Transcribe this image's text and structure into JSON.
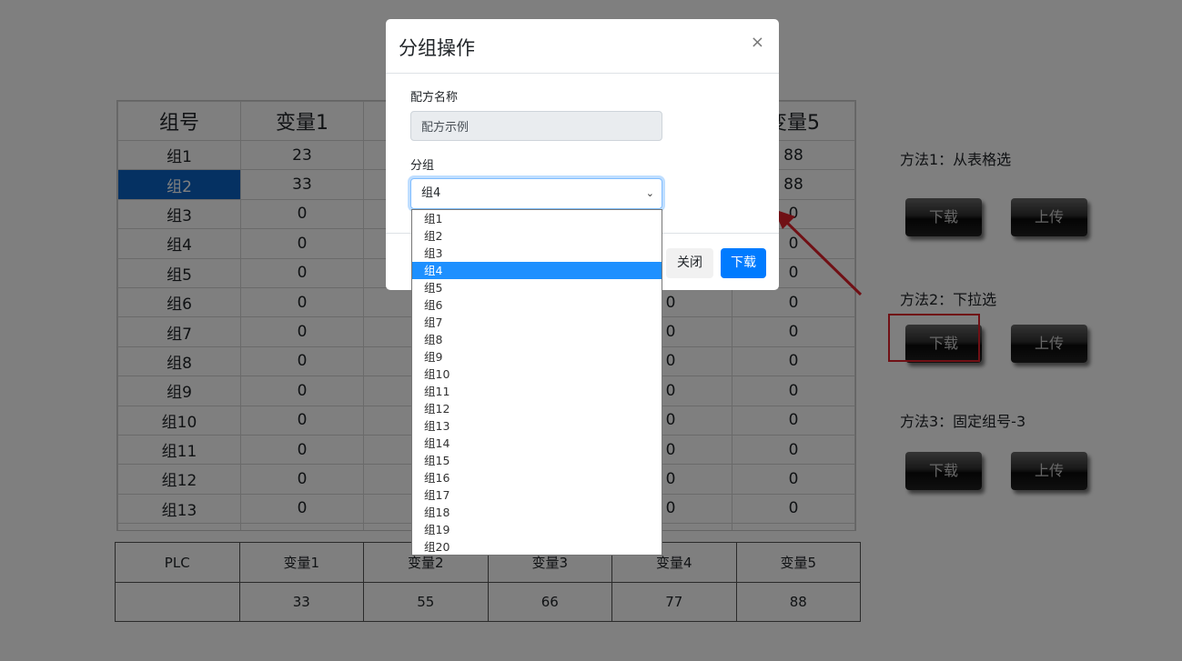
{
  "grid": {
    "headers": [
      "组号",
      "变量1",
      "",
      "",
      "",
      "变量5"
    ],
    "rows": [
      [
        "组1",
        "23",
        "",
        "",
        "",
        "88"
      ],
      [
        "组2",
        "33",
        "",
        "",
        "",
        "88"
      ],
      [
        "组3",
        "0",
        "",
        "",
        "",
        "0"
      ],
      [
        "组4",
        "0",
        "",
        "",
        "",
        "0"
      ],
      [
        "组5",
        "0",
        "",
        "",
        "",
        "0"
      ],
      [
        "组6",
        "0",
        "",
        "",
        "0",
        "0"
      ],
      [
        "组7",
        "0",
        "",
        "",
        "0",
        "0"
      ],
      [
        "组8",
        "0",
        "",
        "",
        "0",
        "0"
      ],
      [
        "组9",
        "0",
        "",
        "",
        "0",
        "0"
      ],
      [
        "组10",
        "0",
        "",
        "",
        "0",
        "0"
      ],
      [
        "组11",
        "0",
        "",
        "",
        "0",
        "0"
      ],
      [
        "组12",
        "0",
        "",
        "",
        "0",
        "0"
      ],
      [
        "组13",
        "0",
        "",
        "",
        "0",
        "0"
      ]
    ],
    "selected_row": 1
  },
  "plc": {
    "headers": [
      "PLC",
      "变量1",
      "变量2",
      "变量3",
      "变量4",
      "变量5"
    ],
    "values": [
      "",
      "33",
      "55",
      "66",
      "77",
      "88"
    ]
  },
  "methods": [
    {
      "label": "方法1：从表格选",
      "download": "下载",
      "upload": "上传"
    },
    {
      "label": "方法2：下拉选",
      "download": "下载",
      "upload": "上传"
    },
    {
      "label": "方法3：固定组号-3",
      "download": "下载",
      "upload": "上传"
    }
  ],
  "modal": {
    "title": "分组操作",
    "close_symbol": "×",
    "recipe_label": "配方名称",
    "recipe_value": "配方示例",
    "group_label": "分组",
    "group_selected": "组4",
    "close_button": "关闭",
    "download_button": "下载"
  },
  "dropdown": {
    "options": [
      "组1",
      "组2",
      "组3",
      "组4",
      "组5",
      "组6",
      "组7",
      "组8",
      "组9",
      "组10",
      "组11",
      "组12",
      "组13",
      "组14",
      "组15",
      "组16",
      "组17",
      "组18",
      "组19",
      "组20"
    ],
    "highlighted": 3
  },
  "colors": {
    "selected_cell": "#0b63c5",
    "primary": "#007bff",
    "annotation_red": "#e0202a",
    "dropdown_highlight": "#1e90ff"
  }
}
